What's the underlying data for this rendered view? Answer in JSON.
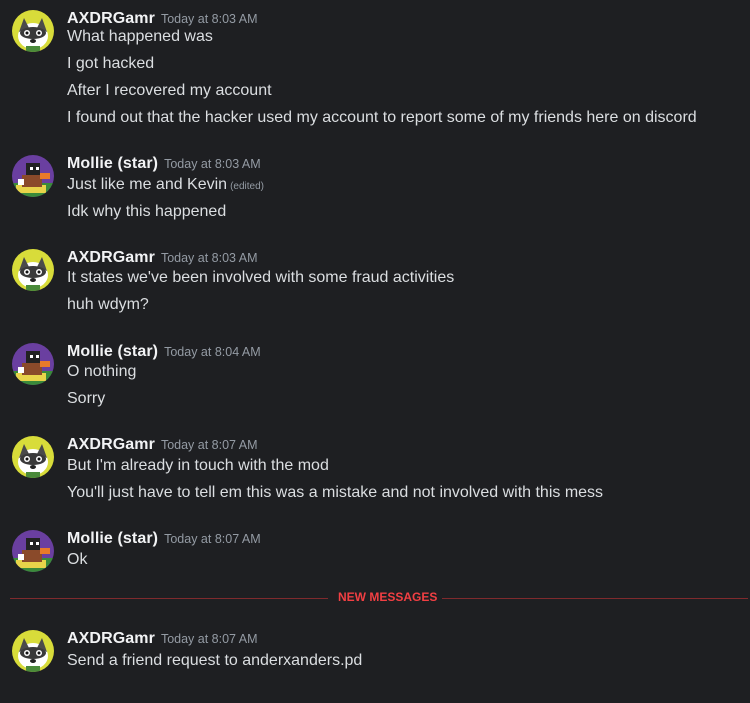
{
  "colors": {
    "background": "#1e1f22",
    "username": "#f2f3f5",
    "text": "#dbdee1",
    "timestamp": "#949ba4",
    "new_messages": "#f23f43"
  },
  "messages": [
    {
      "author": "AXDRGamr",
      "avatar": "raccoon-avatar-icon",
      "timestamp": "Today at 8:03 AM",
      "lines": [
        "What happened was",
        "I got hacked",
        "After I recovered my account",
        "I found out that the hacker used my account to report some of my friends here on discord"
      ]
    },
    {
      "author": "Mollie (star)",
      "avatar": "pixel-character-avatar-icon",
      "timestamp": "Today at 8:03 AM",
      "lines": [
        "Just like me and Kevin",
        "Idk why this happened"
      ],
      "edited_label": "(edited)"
    },
    {
      "author": "AXDRGamr",
      "avatar": "raccoon-avatar-icon",
      "timestamp": "Today at 8:03 AM",
      "lines": [
        "It states we've been involved with some fraud activities",
        "huh wdym?"
      ]
    },
    {
      "author": "Mollie (star)",
      "avatar": "pixel-character-avatar-icon",
      "timestamp": "Today at 8:04 AM",
      "lines": [
        "O nothing",
        "Sorry"
      ]
    },
    {
      "author": "AXDRGamr",
      "avatar": "raccoon-avatar-icon",
      "timestamp": "Today at 8:07 AM",
      "lines": [
        "But I'm already in touch with the mod",
        "You'll just have to tell em this was a mistake and not involved with this mess"
      ]
    },
    {
      "author": "Mollie (star)",
      "avatar": "pixel-character-avatar-icon",
      "timestamp": "Today at 8:07 AM",
      "lines": [
        "Ok"
      ]
    },
    {
      "author": "AXDRGamr",
      "avatar": "raccoon-avatar-icon",
      "timestamp": "Today at 8:07 AM",
      "lines": [
        "Send a friend request to anderxanders.pd"
      ]
    }
  ],
  "divider": {
    "label": "NEW MESSAGES"
  }
}
